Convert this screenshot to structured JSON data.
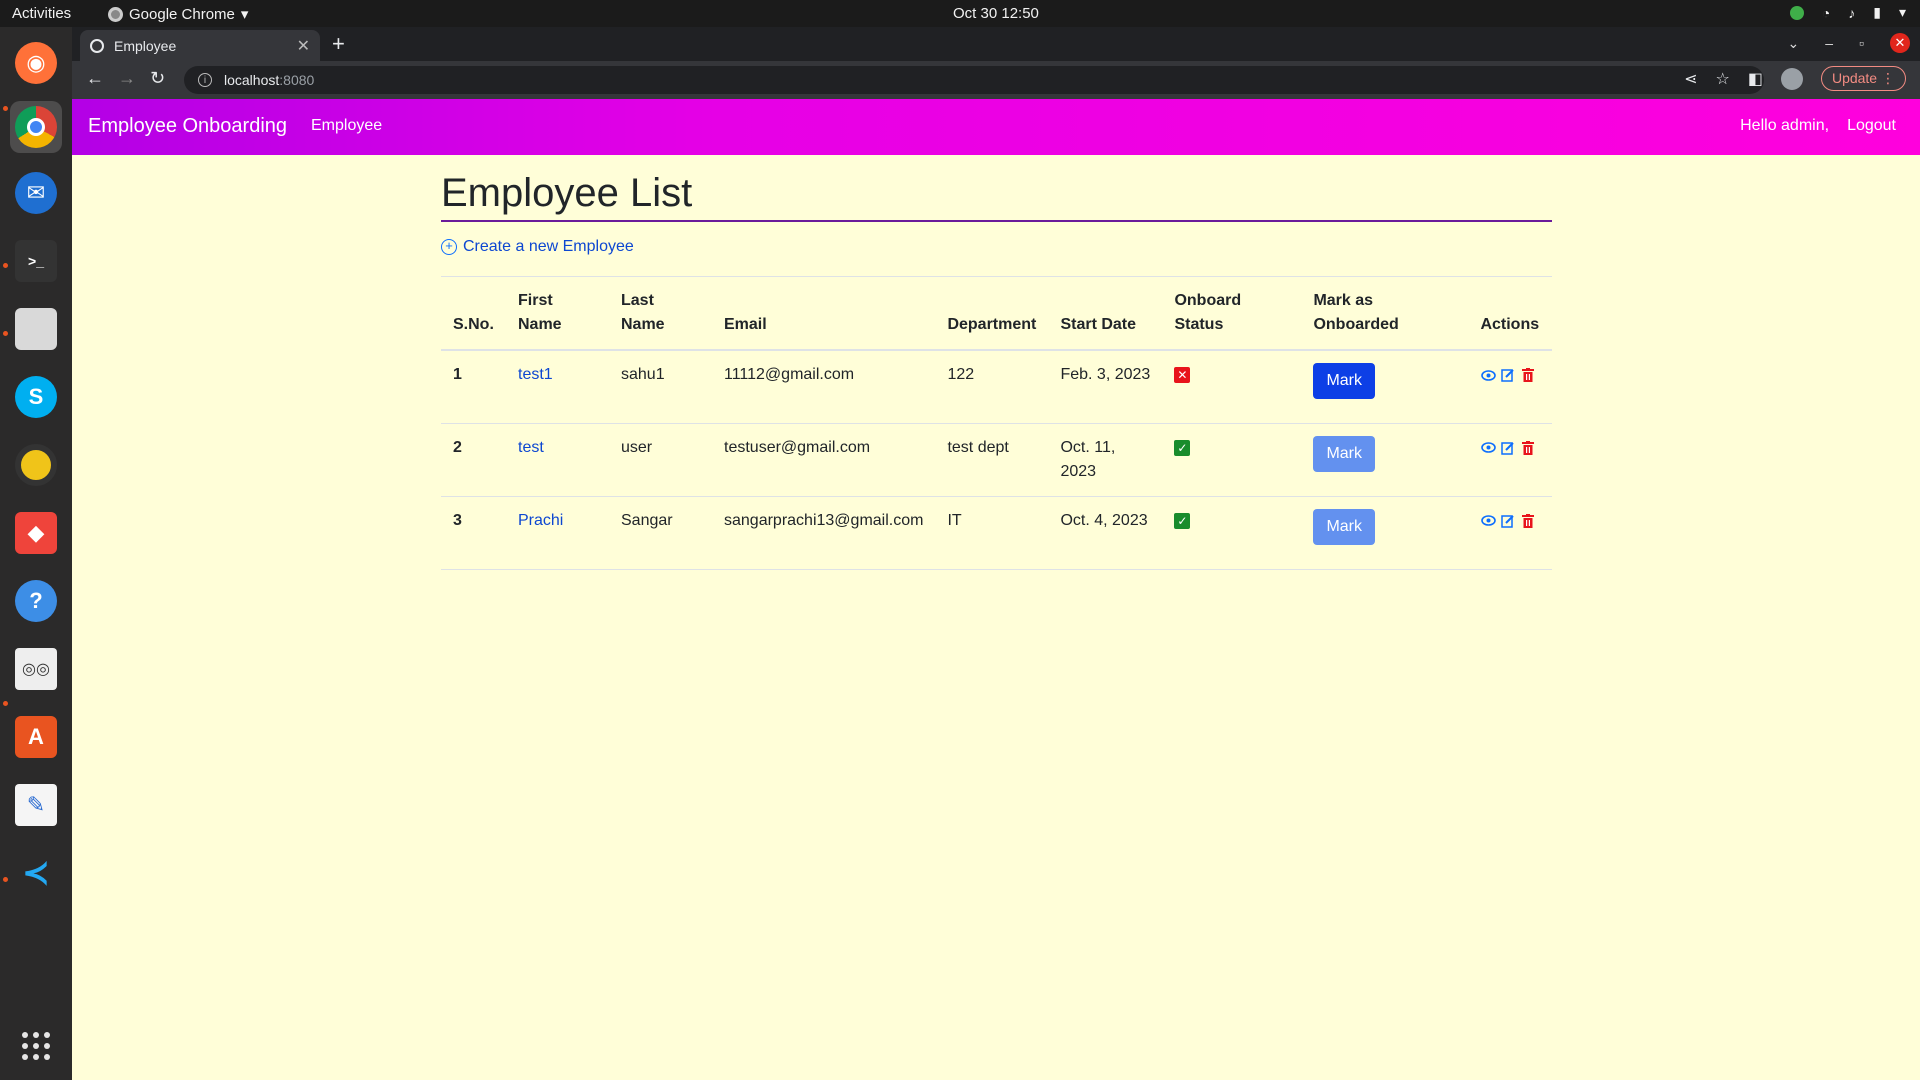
{
  "system": {
    "activities": "Activities",
    "app_name": "Google Chrome",
    "clock": "Oct 30  12:50"
  },
  "browser": {
    "tab_title": "Employee",
    "url_host": "localhost",
    "url_port": ":8080",
    "update_label": "Update"
  },
  "navbar": {
    "brand": "Employee Onboarding",
    "link": "Employee",
    "greeting": "Hello admin,",
    "logout": "Logout",
    "color_start": "#b300e6",
    "color_end": "#ff00dd"
  },
  "main": {
    "title": "Employee List",
    "create_link": "Create a new Employee"
  },
  "table": {
    "headers": {
      "sno": "S.No.",
      "first_name": "First Name",
      "last_name": "Last Name",
      "email": "Email",
      "department": "Department",
      "start_date": "Start Date",
      "onboard_status": "Onboard Status",
      "mark": "Mark as Onboarded",
      "actions": "Actions"
    },
    "rows": [
      {
        "sno": "1",
        "first_name": "test1",
        "last_name": "sahu1",
        "email": "11112@gmail.com",
        "department": "122",
        "start_date": "Feb. 3, 2023",
        "onboarded": false,
        "mark_label": "Mark"
      },
      {
        "sno": "2",
        "first_name": "test",
        "last_name": "user",
        "email": "testuser@gmail.com",
        "department": "test dept",
        "start_date": "Oct. 11, 2023",
        "onboarded": true,
        "mark_label": "Mark"
      },
      {
        "sno": "3",
        "first_name": "Prachi",
        "last_name": "Sangar",
        "email": "sangarprachi13@gmail.com",
        "department": "IT",
        "start_date": "Oct. 4, 2023",
        "onboarded": true,
        "mark_label": "Mark"
      }
    ]
  }
}
